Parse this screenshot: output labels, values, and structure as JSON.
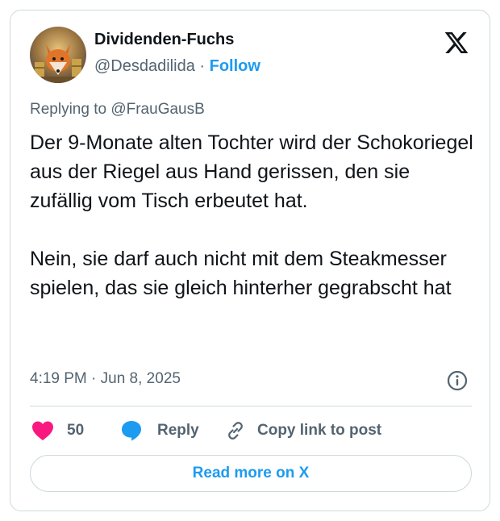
{
  "author": {
    "name": "Dividenden-Fuchs",
    "handle": "@Desdadilida",
    "separator": "·",
    "follow_label": "Follow",
    "avatar_icon": "fox-avatar"
  },
  "brand": {
    "logo_icon": "x-logo-icon"
  },
  "tweet": {
    "replying_to": "Replying to @FrauGausB",
    "paragraphs": [
      "Der 9-Monate alten Tochter wird der Schokoriegel aus der Riegel aus Hand gerissen, den sie zufällig vom Tisch erbeutet hat.",
      "Nein, sie darf auch nicht mit dem Steakmesser spielen, das sie gleich hinterher gegrabscht hat"
    ],
    "timestamp": "4:19 PM · Jun 8, 2025"
  },
  "actions": {
    "like_count": "50",
    "reply_label": "Reply",
    "copy_label": "Copy link to post"
  },
  "footer": {
    "read_more_label": "Read more on X"
  },
  "colors": {
    "accent": "#1d9bf0",
    "like": "#f91880",
    "text": "#0f1419",
    "muted": "#536471",
    "border": "#cfd9de"
  }
}
